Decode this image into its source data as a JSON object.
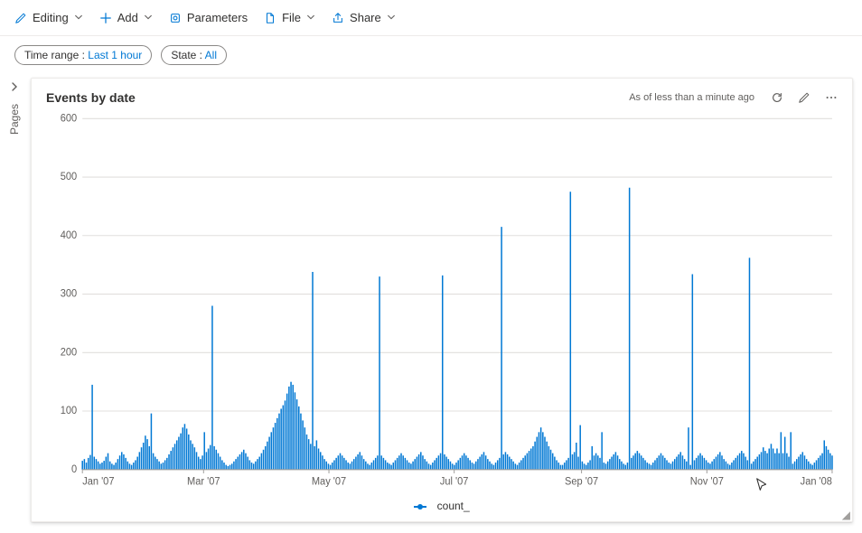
{
  "toolbar": {
    "editing_label": "Editing",
    "add_label": "Add",
    "parameters_label": "Parameters",
    "file_label": "File",
    "share_label": "Share"
  },
  "pills": {
    "time_range_key": "Time range :",
    "time_range_value": "Last 1 hour",
    "state_key": "State :",
    "state_value": "All"
  },
  "side_rail": {
    "label": "Pages"
  },
  "panel": {
    "title": "Events by date",
    "status": "As of less than a minute ago"
  },
  "legend": {
    "series_label": "count_"
  },
  "chart_data": {
    "type": "bar",
    "title": "Events by date",
    "xlabel": "",
    "ylabel": "",
    "ylim": [
      0,
      600
    ],
    "y_ticks": [
      0,
      100,
      200,
      300,
      400,
      500,
      600
    ],
    "x_tick_labels": [
      "Jan '07",
      "Mar '07",
      "May '07",
      "Jul '07",
      "Sep '07",
      "Nov '07",
      "Jan '08"
    ],
    "x_tick_positions_days": [
      0,
      59,
      120,
      181,
      243,
      304,
      365
    ],
    "x_range_days": [
      0,
      365
    ],
    "series": [
      {
        "name": "count_",
        "values": [
          15,
          18,
          12,
          20,
          25,
          145,
          22,
          18,
          14,
          10,
          12,
          15,
          22,
          28,
          14,
          10,
          8,
          12,
          18,
          24,
          30,
          26,
          20,
          14,
          10,
          8,
          12,
          16,
          22,
          30,
          38,
          46,
          58,
          52,
          40,
          96,
          28,
          22,
          18,
          14,
          10,
          12,
          16,
          20,
          26,
          32,
          38,
          44,
          50,
          56,
          62,
          72,
          78,
          70,
          60,
          50,
          44,
          38,
          30,
          22,
          18,
          24,
          64,
          30,
          36,
          42,
          280,
          40,
          34,
          28,
          22,
          16,
          12,
          8,
          6,
          8,
          10,
          14,
          18,
          22,
          26,
          30,
          34,
          28,
          22,
          16,
          12,
          10,
          14,
          18,
          22,
          28,
          34,
          40,
          48,
          56,
          64,
          72,
          80,
          88,
          96,
          104,
          110,
          118,
          130,
          142,
          150,
          145,
          132,
          120,
          108,
          96,
          84,
          72,
          60,
          52,
          44,
          338,
          40,
          50,
          36,
          30,
          24,
          18,
          14,
          10,
          8,
          12,
          16,
          20,
          24,
          28,
          24,
          20,
          16,
          12,
          10,
          14,
          18,
          22,
          26,
          30,
          24,
          18,
          14,
          10,
          8,
          12,
          16,
          20,
          24,
          330,
          24,
          20,
          16,
          12,
          10,
          8,
          12,
          16,
          20,
          24,
          28,
          24,
          20,
          16,
          12,
          10,
          14,
          18,
          22,
          26,
          30,
          24,
          18,
          14,
          10,
          8,
          12,
          16,
          20,
          24,
          28,
          332,
          26,
          22,
          18,
          14,
          10,
          8,
          12,
          16,
          20,
          24,
          28,
          24,
          20,
          16,
          12,
          10,
          14,
          18,
          22,
          26,
          30,
          24,
          18,
          14,
          10,
          8,
          12,
          16,
          20,
          415,
          26,
          30,
          26,
          22,
          18,
          14,
          10,
          8,
          12,
          16,
          20,
          24,
          28,
          32,
          36,
          40,
          48,
          56,
          64,
          72,
          64,
          56,
          48,
          40,
          34,
          28,
          22,
          16,
          12,
          8,
          8,
          12,
          16,
          20,
          475,
          26,
          30,
          46,
          22,
          76,
          14,
          10,
          8,
          12,
          16,
          40,
          24,
          28,
          24,
          20,
          64,
          12,
          10,
          14,
          18,
          22,
          26,
          30,
          24,
          18,
          14,
          10,
          8,
          12,
          482,
          20,
          24,
          28,
          32,
          28,
          24,
          20,
          16,
          12,
          10,
          8,
          12,
          16,
          20,
          24,
          28,
          24,
          20,
          16,
          12,
          10,
          14,
          18,
          22,
          26,
          30,
          24,
          18,
          14,
          72,
          8,
          334,
          16,
          20,
          24,
          28,
          24,
          20,
          16,
          12,
          10,
          14,
          18,
          22,
          26,
          30,
          24,
          18,
          14,
          10,
          8,
          12,
          16,
          20,
          24,
          28,
          32,
          28,
          22,
          16,
          362,
          10,
          14,
          18,
          22,
          26,
          30,
          38,
          32,
          28,
          36,
          44,
          36,
          28,
          36,
          28,
          64,
          28,
          56,
          28,
          22,
          64,
          10,
          14,
          18,
          22,
          26,
          30,
          24,
          18,
          14,
          10,
          8,
          12,
          16,
          20,
          24,
          28,
          50,
          40,
          34,
          28,
          24
        ]
      }
    ]
  }
}
